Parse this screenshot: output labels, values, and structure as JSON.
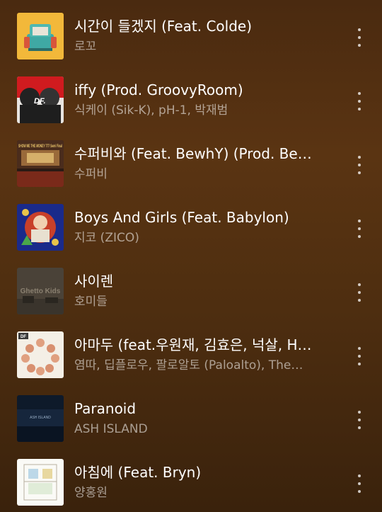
{
  "tracks": [
    {
      "title": "시간이 들겠지 (Feat. Colde)",
      "artist": "로꼬"
    },
    {
      "title": "iffy (Prod. GroovyRoom)",
      "artist": "식케이 (Sik-K), pH-1, 박재범"
    },
    {
      "title": "수퍼비와 (Feat. BewhY) (Prod. Be…",
      "artist": "수퍼비"
    },
    {
      "title": "Boys And Girls (Feat. Babylon)",
      "artist": "지코 (ZICO)"
    },
    {
      "title": "사이렌",
      "artist": "호미들"
    },
    {
      "title": "아마두 (feat.우원재, 김효은, 넉살, H…",
      "artist": "염따, 딥플로우, 팔로알토 (Paloalto), The…"
    },
    {
      "title": "Paranoid",
      "artist": "ASH ISLAND"
    },
    {
      "title": "아침에 (Feat. Bryn)",
      "artist": "양홍원"
    }
  ],
  "album_art_text": {
    "iffy": "DF.",
    "supervi": "SHOW ME THE MONEY 777 Semi Final",
    "sirens": "Ghetto Kids",
    "amadu": "DF",
    "paranoid": "ASH ISLAND"
  },
  "more_icon": "more-vertical-icon"
}
